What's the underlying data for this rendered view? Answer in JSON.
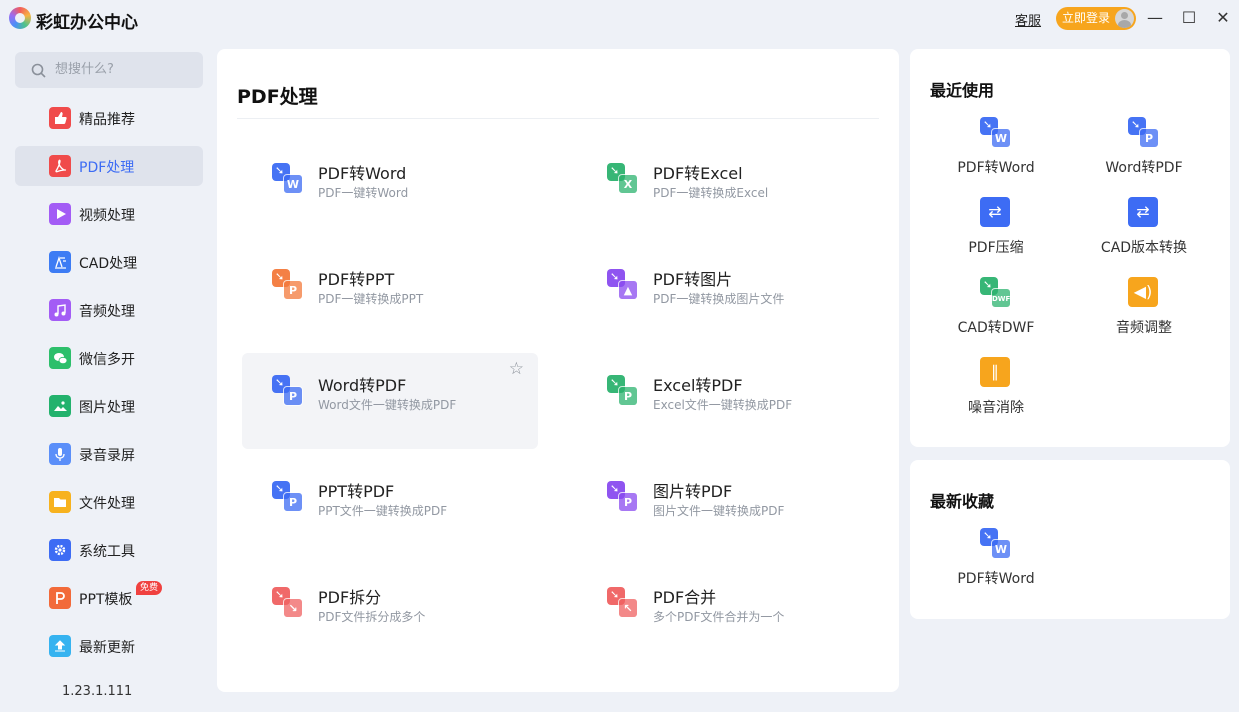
{
  "app": {
    "title": "彩虹办公中心",
    "service": "客服",
    "login": "立即登录"
  },
  "window_controls": {
    "minimize": "—",
    "maximize": "☐",
    "close": "✕"
  },
  "search": {
    "placeholder": "想搜什么?"
  },
  "sidebar": {
    "items": [
      {
        "label": "精品推荐",
        "icon": "thumbs-up-icon",
        "color": "#f04b4b"
      },
      {
        "label": "PDF处理",
        "icon": "pdf-icon",
        "color": "#f04b4b",
        "active": true
      },
      {
        "label": "视频处理",
        "icon": "video-play-icon",
        "color": "#a35cf5"
      },
      {
        "label": "CAD处理",
        "icon": "cad-icon",
        "color": "#3d7cf4"
      },
      {
        "label": "音频处理",
        "icon": "music-note-icon",
        "color": "#a35cf5"
      },
      {
        "label": "微信多开",
        "icon": "wechat-icon",
        "color": "#2dbf6b"
      },
      {
        "label": "图片处理",
        "icon": "image-icon",
        "color": "#23b26d"
      },
      {
        "label": "录音录屏",
        "icon": "microphone-icon",
        "color": "#5b8ff9"
      },
      {
        "label": "文件处理",
        "icon": "folder-icon",
        "color": "#f7b21e"
      },
      {
        "label": "系统工具",
        "icon": "gear-icon",
        "color": "#3d6cf4"
      },
      {
        "label": "PPT模板",
        "icon": "ppt-template-icon",
        "color": "#f26a3a",
        "badge": "免费"
      },
      {
        "label": "最新更新",
        "icon": "upload-icon",
        "color": "#36b3f0"
      }
    ],
    "version": "1.23.1.111"
  },
  "main": {
    "title": "PDF处理",
    "tools": [
      {
        "name": "PDF转Word",
        "desc": "PDF一键转Word",
        "icon": "pdf-to-word-icon",
        "back": "#3d6cf4",
        "front": "#3d6cf4",
        "letter": "W"
      },
      {
        "name": "PDF转Excel",
        "desc": "PDF一键转换成Excel",
        "icon": "pdf-to-excel-icon",
        "back": "#2db36f",
        "front": "#2db36f",
        "letter": "X"
      },
      {
        "name": "PDF转PPT",
        "desc": "PDF一键转换成PPT",
        "icon": "pdf-to-ppt-icon",
        "back": "#f47a3c",
        "front": "#f47a3c",
        "letter": "P"
      },
      {
        "name": "PDF转图片",
        "desc": "PDF一键转换成图片文件",
        "icon": "pdf-to-image-icon",
        "back": "#8a4bf0",
        "front": "#8a4bf0",
        "letter": "▲"
      },
      {
        "name": "Word转PDF",
        "desc": "Word文件一键转换成PDF",
        "icon": "word-to-pdf-icon",
        "back": "#3d6cf4",
        "front": "#3d6cf4",
        "letter": "P",
        "hover": true
      },
      {
        "name": "Excel转PDF",
        "desc": "Excel文件一键转换成PDF",
        "icon": "excel-to-pdf-icon",
        "back": "#2db36f",
        "front": "#2db36f",
        "letter": "P"
      },
      {
        "name": "PPT转PDF",
        "desc": "PPT文件一键转换成PDF",
        "icon": "ppt-to-pdf-icon",
        "back": "#3d6cf4",
        "front": "#3d6cf4",
        "letter": "P"
      },
      {
        "name": "图片转PDF",
        "desc": "图片文件一键转换成PDF",
        "icon": "image-to-pdf-icon",
        "back": "#8a4bf0",
        "front": "#8a4bf0",
        "letter": "P"
      },
      {
        "name": "PDF拆分",
        "desc": "PDF文件拆分成多个",
        "icon": "pdf-split-icon",
        "back": "#f06262",
        "front": "#f06262",
        "letter": "↘"
      },
      {
        "name": "PDF合并",
        "desc": "多个PDF文件合并为一个",
        "icon": "pdf-merge-icon",
        "back": "#f06262",
        "front": "#f06262",
        "letter": "↖"
      }
    ]
  },
  "recent": {
    "title": "最近使用",
    "items": [
      {
        "label": "PDF转Word",
        "icon": "pdf-to-word-icon",
        "color": "#3d6cf4",
        "letter": "W"
      },
      {
        "label": "Word转PDF",
        "icon": "word-to-pdf-icon",
        "color": "#3d6cf4",
        "letter": "P"
      },
      {
        "label": "PDF压缩",
        "icon": "pdf-compress-icon",
        "color": "#3d6cf4",
        "letter": ""
      },
      {
        "label": "CAD版本转换",
        "icon": "cad-version-convert-icon",
        "color": "#3d6cf4",
        "letter": ""
      },
      {
        "label": "CAD转DWF",
        "icon": "cad-to-dwf-icon",
        "color": "#2db36f",
        "letter": "DWF"
      },
      {
        "label": "音频调整",
        "icon": "audio-adjust-icon",
        "color": "#f7a51d",
        "letter": ""
      },
      {
        "label": "噪音消除",
        "icon": "noise-removal-icon",
        "color": "#f7a51d",
        "letter": ""
      }
    ]
  },
  "favorites": {
    "title": "最新收藏",
    "items": [
      {
        "label": "PDF转Word",
        "icon": "pdf-to-word-icon",
        "color": "#3d6cf4",
        "letter": "W"
      }
    ]
  }
}
